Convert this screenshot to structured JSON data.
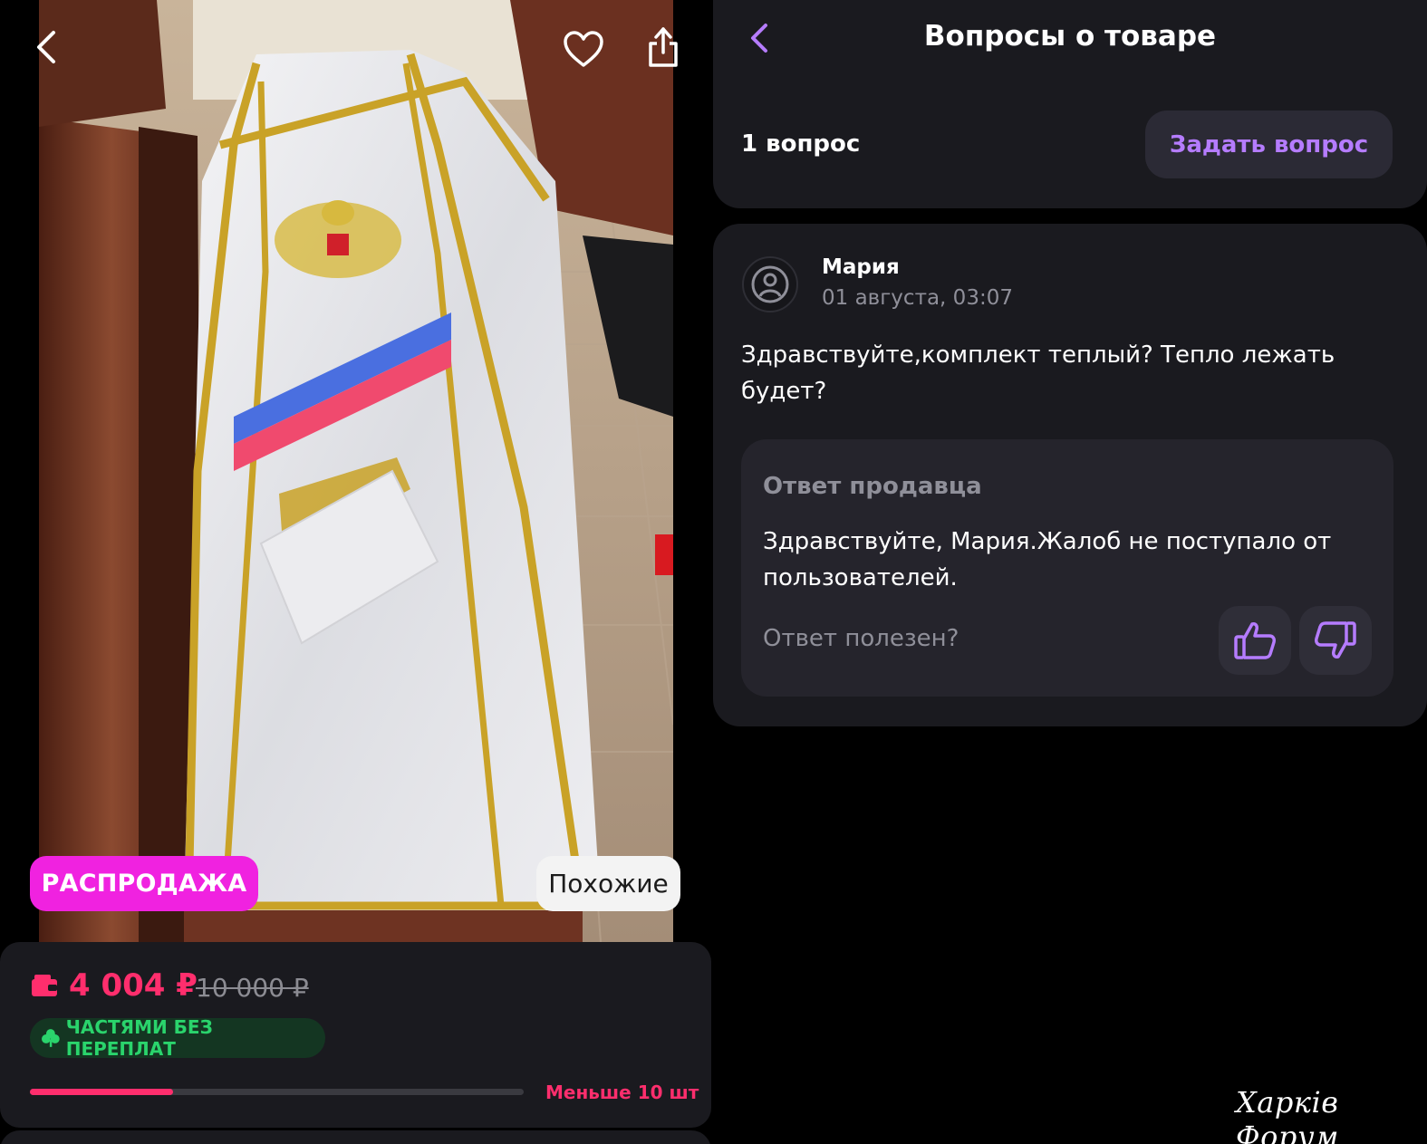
{
  "left": {
    "icons": {
      "back": "chevron-left-icon",
      "favorite": "heart-icon",
      "share": "share-icon",
      "wallet": "wallet-icon",
      "installment": "clover-icon"
    },
    "sale_badge": "РАСПРОДАЖА",
    "similar_button": "Похожие",
    "price": "4 004 ₽",
    "old_price": "10 000 ₽",
    "installment_label": "ЧАСТЯМИ БЕЗ ПЕРЕПЛАТ",
    "stock_level": 0.29,
    "stock_text": "Меньше 10 шт",
    "colors": {
      "sale": "#f022e0",
      "price": "#ff2e6d",
      "installment": "#2ad46c"
    }
  },
  "right": {
    "title": "Вопросы о товаре",
    "question_count": "1 вопрос",
    "ask_button": "Задать вопрос",
    "question": {
      "author": "Мария",
      "date": "01 августа, 03:07",
      "text": "Здравствуйте,комплект теплый? Тепло лежать будет?"
    },
    "answer": {
      "label": "Ответ продавца",
      "text": "Здравствуйте, Мария.Жалоб не поступало от пользователей.",
      "helpful_prompt": "Ответ полезен?"
    },
    "icons": {
      "back": "chevron-left-icon",
      "avatar": "user-avatar-icon",
      "like": "thumb-up-icon",
      "dislike": "thumb-down-icon"
    },
    "accent_color": "#b57cff"
  },
  "watermark": "Харків Форум"
}
